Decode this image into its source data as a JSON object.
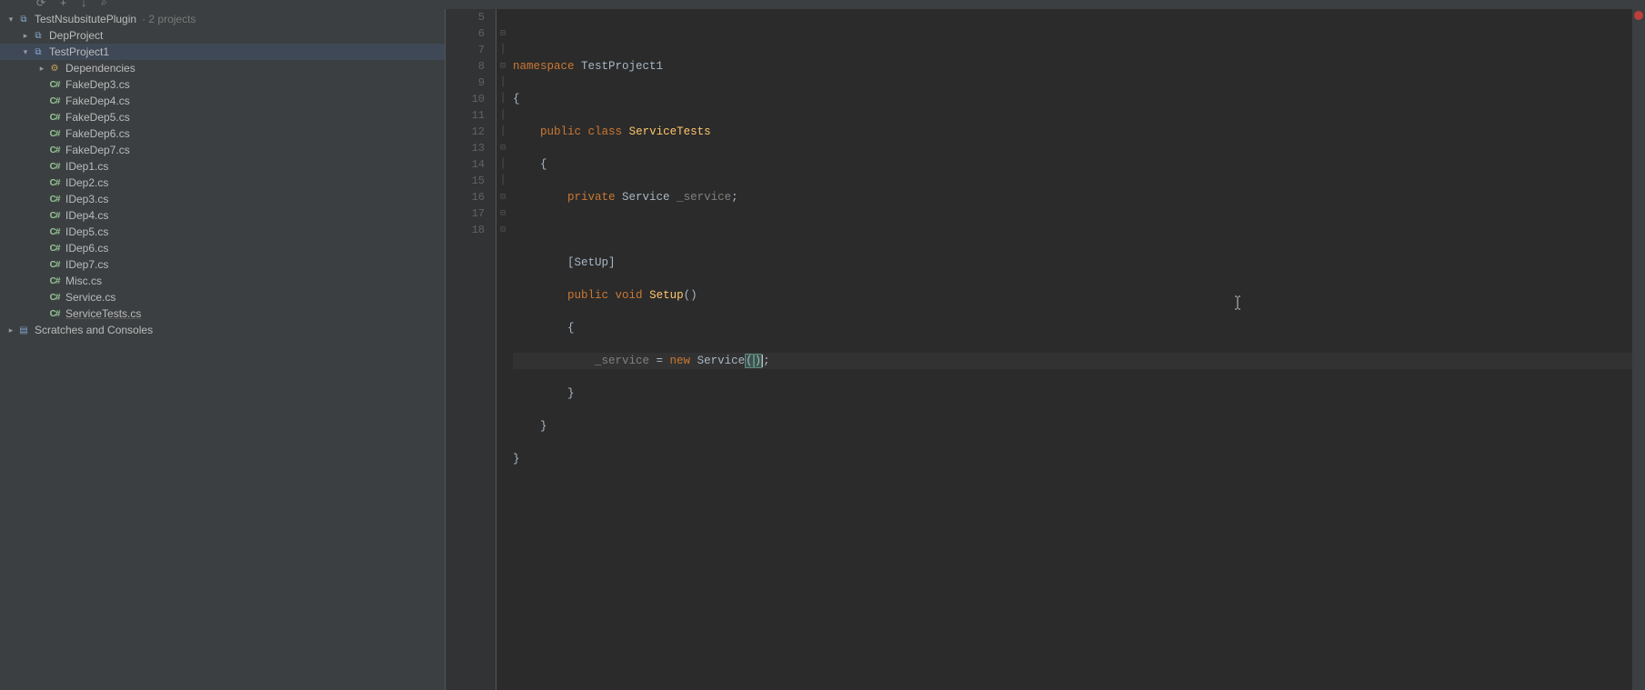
{
  "toolbar": {
    "icons": [
      "sync",
      "plus",
      "down",
      "search"
    ]
  },
  "tree": {
    "solution": {
      "name": "TestNsubsitutePlugin",
      "hint": "· 2 projects"
    },
    "depProject": "DepProject",
    "testProject": "TestProject1",
    "dependencies": "Dependencies",
    "files": [
      "FakeDep3.cs",
      "FakeDep4.cs",
      "FakeDep5.cs",
      "FakeDep6.cs",
      "FakeDep7.cs",
      "IDep1.cs",
      "IDep2.cs",
      "IDep3.cs",
      "IDep4.cs",
      "IDep5.cs",
      "IDep6.cs",
      "IDep7.cs",
      "Misc.cs",
      "Service.cs",
      "ServiceTests.cs"
    ],
    "scratches": "Scratches and Consoles"
  },
  "editor": {
    "lineStart": 5,
    "code": {
      "l5": "",
      "l6_kw": "namespace",
      "l6_ns": " TestProject1",
      "l7": "{",
      "l8_kw1": "public",
      "l8_kw2": "class",
      "l8_cls": "ServiceTests",
      "l9": "{",
      "l10_kw": "private",
      "l10_type": "Service",
      "l10_var": "_service",
      "l10_semi": ";",
      "l11": "",
      "l12_attr_open": "[",
      "l12_attr": "SetUp",
      "l12_attr_close": "]",
      "l13_kw1": "public",
      "l13_kw2": "void",
      "l13_m": "Setup",
      "l13_paren": "()",
      "l14": "{",
      "l15_var": "_service",
      "l15_eq": " = ",
      "l15_new": "new",
      "l15_type": " Service",
      "l15_open": "(",
      "l15_close": ")",
      "l15_semi": ";",
      "l16": "}",
      "l17": "}",
      "l18": "}"
    },
    "gutter": [
      "5",
      "6",
      "7",
      "8",
      "9",
      "10",
      "11",
      "12",
      "13",
      "14",
      "15",
      "16",
      "17",
      "18"
    ]
  }
}
